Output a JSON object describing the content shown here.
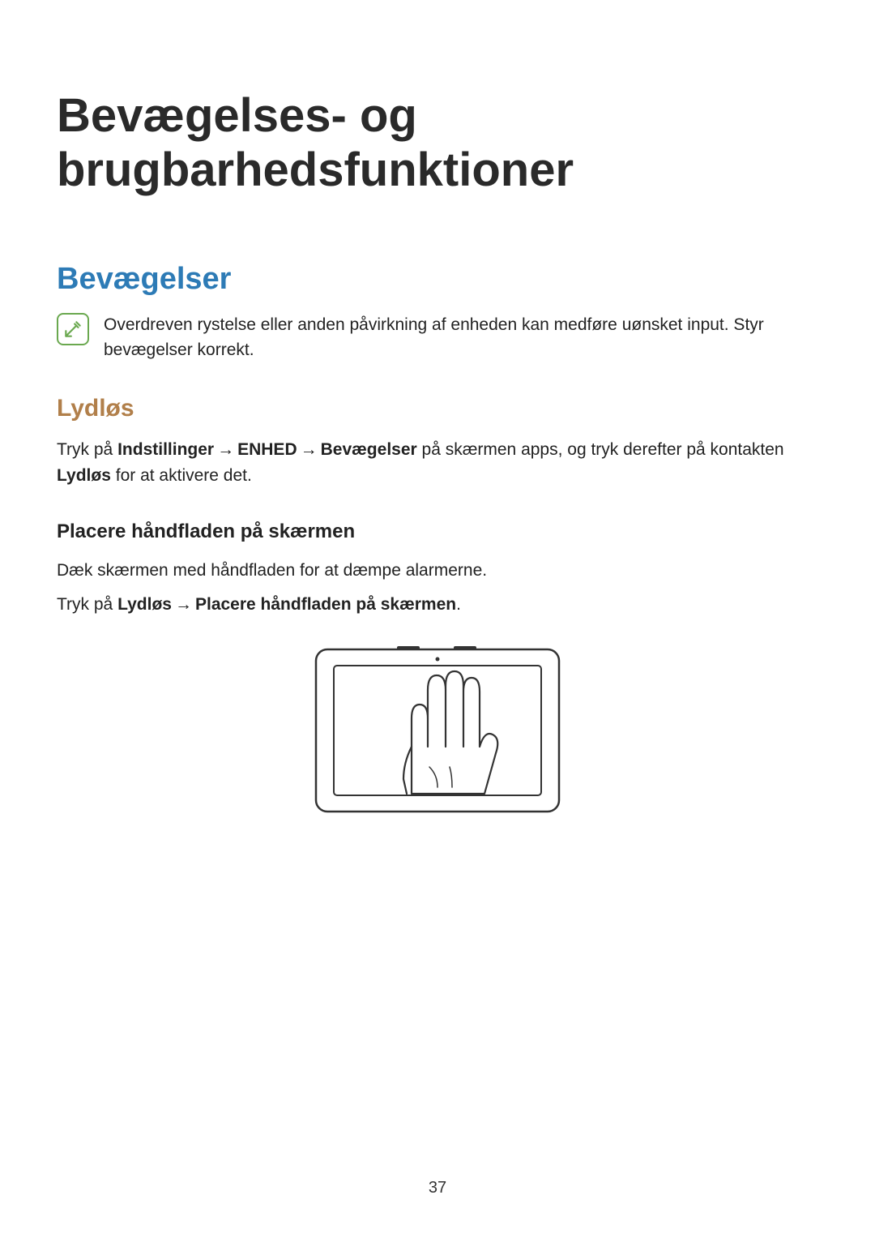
{
  "title": "Bevægelses- og brugbarhedsfunktioner",
  "section1": {
    "heading": "Bevægelser",
    "note": "Overdreven rystelse eller anden påvirkning af enheden kan medføre uønsket input. Styr bevægelser korrekt."
  },
  "section2": {
    "heading": "Lydløs",
    "para1_pre": "Tryk på ",
    "para1_b1": "Indstillinger",
    "para1_arrow": " → ",
    "para1_b2": "ENHED",
    "para1_b3": "Bevægelser",
    "para1_mid": " på skærmen apps, og tryk derefter på kontakten ",
    "para1_b4": "Lydløs",
    "para1_post": " for at aktivere det."
  },
  "section3": {
    "heading": "Placere håndfladen på skærmen",
    "para1": "Dæk skærmen med håndfladen for at dæmpe alarmerne.",
    "para2_pre": "Tryk på ",
    "para2_b1": "Lydløs",
    "para2_arrow": " → ",
    "para2_b2": "Placere håndfladen på skærmen",
    "para2_post": "."
  },
  "pageNumber": "37"
}
